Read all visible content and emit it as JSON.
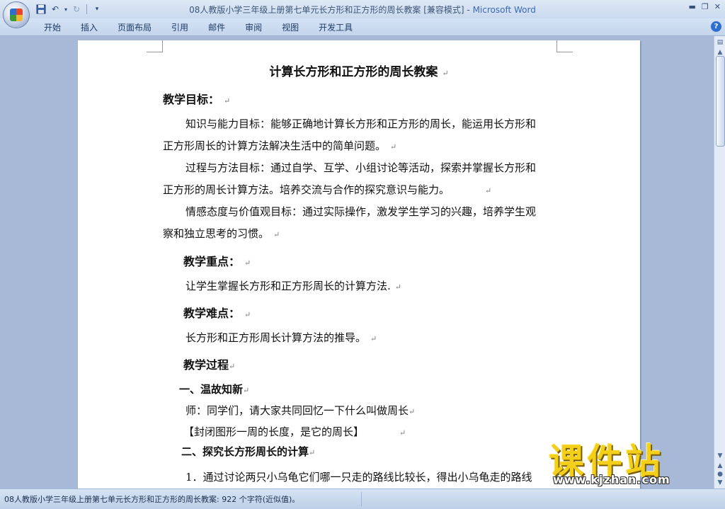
{
  "window": {
    "title": "08人教版小学三年级上册第七单元长方形和正方形的周长教案 [兼容模式]",
    "title_sep": " - ",
    "app_name": "Microsoft Word"
  },
  "qat": {
    "save_icon": "save-icon",
    "undo_icon": "undo-icon",
    "redo_icon": "redo-icon",
    "customize_icon": "customize-icon"
  },
  "ribbon": {
    "tabs": [
      "开始",
      "插入",
      "页面布局",
      "引用",
      "邮件",
      "审阅",
      "视图",
      "开发工具"
    ],
    "help_label": "?"
  },
  "document": {
    "title": "计算长方形和正方形的周长教案",
    "para_mark": "↵",
    "lines": [
      "教学目标：",
      "知识与能力目标：能够正确地计算长方形和正方形的周长，能运用长方形和",
      "正方形周长的计算方法解决生活中的简单问题。",
      "过程与方法目标：通过自学、互学、小组讨论等活动，探索并掌握长方形和",
      "正方形的周长计算方法。培养交流与合作的探究意识与能力。",
      "情感态度与价值观目标：通过实际操作，激发学生学习的兴趣，培养学生观",
      "察和独立思考的习惯。",
      "教学重点：",
      "让学生掌握长方形和正方形周长的计算方法.",
      "教学难点：",
      "长方形和正方形周长计算方法的推导。",
      "教学过程",
      "一、温故知新",
      "师：同学们，请大家共同回忆一下什么叫做周长",
      "【封闭图形一周的长度，是它的周长】",
      "二、探究长方形周长的计算",
      "1．通过讨论两只小乌龟它们哪一只走的路线比较长，得出小乌龟走的路线"
    ]
  },
  "statusbar": {
    "text": "08人教版小学三年级上册第七单元长方形和正方形的周长教案: 922 个字符(近似值)。"
  },
  "watermark": {
    "cn": "课件站",
    "url": "www.kjzhan.com"
  }
}
